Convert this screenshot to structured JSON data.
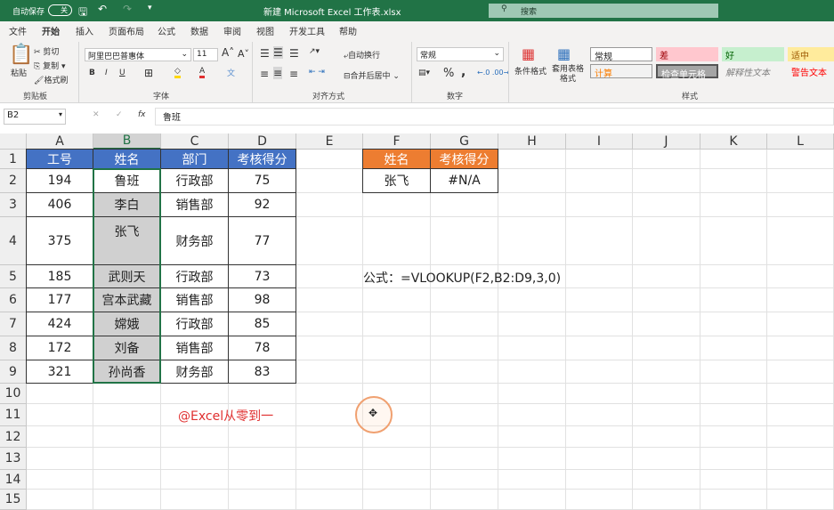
{
  "titlebar": {
    "autosave": "自动保存",
    "toggle": "关",
    "title": "新建 Microsoft Excel 工作表.xlsx",
    "search": "搜索"
  },
  "tabs": [
    "文件",
    "开始",
    "插入",
    "页面布局",
    "公式",
    "数据",
    "审阅",
    "视图",
    "开发工具",
    "帮助"
  ],
  "ribbon": {
    "clipboard": {
      "paste": "粘贴",
      "cut": "剪切",
      "copy": "复制",
      "format_painter": "格式刷",
      "label": "剪贴板"
    },
    "font": {
      "name": "阿里巴巴普惠体",
      "size": "11",
      "bold": "B",
      "italic": "I",
      "underline": "U",
      "label": "字体"
    },
    "align": {
      "wrap": "自动换行",
      "merge": "合并后居中",
      "label": "对齐方式"
    },
    "number": {
      "format": "常规",
      "percent": "%",
      "comma": ",",
      "label": "数字"
    },
    "styles": {
      "cond": "条件格式",
      "table": "套用表格格式",
      "label": "样式",
      "items": [
        {
          "t": "常规",
          "bg": "#ffffff",
          "fg": "#222222"
        },
        {
          "t": "差",
          "bg": "#ffc7ce",
          "fg": "#9c0006"
        },
        {
          "t": "好",
          "bg": "#c6efce",
          "fg": "#006100"
        },
        {
          "t": "适中",
          "bg": "#ffeb9c",
          "fg": "#9c5700"
        },
        {
          "t": "计算",
          "bg": "#f2f2f2",
          "fg": "#fa7d00"
        },
        {
          "t": "检查单元格",
          "bg": "#a5a5a5",
          "fg": "#ffffff"
        },
        {
          "t": "解释性文本",
          "bg": "#f3f2f1",
          "fg": "#7f7f7f"
        },
        {
          "t": "警告文本",
          "bg": "#f3f2f1",
          "fg": "#ff0000"
        }
      ]
    }
  },
  "formula_bar": {
    "name_box": "B2",
    "fx": "fx",
    "value": "鲁班"
  },
  "columns": [
    "A",
    "B",
    "C",
    "D",
    "E",
    "F",
    "G",
    "H",
    "I",
    "J",
    "K",
    "L"
  ],
  "rows": [
    "1",
    "2",
    "3",
    "4",
    "5",
    "6",
    "7",
    "8",
    "9",
    "10",
    "11",
    "12",
    "13",
    "14",
    "15"
  ],
  "table": {
    "headers": [
      "工号",
      "姓名",
      "部门",
      "考核得分"
    ],
    "rows": [
      [
        "194",
        "鲁班",
        "行政部",
        "75"
      ],
      [
        "406",
        "李白",
        "销售部",
        "92"
      ],
      [
        "375",
        "张飞",
        "财务部",
        "77"
      ],
      [
        "185",
        "武则天",
        "行政部",
        "73"
      ],
      [
        "177",
        "宫本武藏",
        "销售部",
        "98"
      ],
      [
        "424",
        "嫦娥",
        "行政部",
        "85"
      ],
      [
        "172",
        "刘备",
        "销售部",
        "78"
      ],
      [
        "321",
        "孙尚香",
        "财务部",
        "83"
      ]
    ]
  },
  "lookup": {
    "headers": [
      "姓名",
      "考核得分"
    ],
    "values": [
      "张飞",
      "#N/A"
    ]
  },
  "formula_note": "公式：=VLOOKUP(F2,B2:D9,3,0)",
  "watermark": "@Excel从零到一",
  "colors": {
    "green": "#217346",
    "blue": "#4472c4",
    "orange": "#ed7d31",
    "selection": "#d0d0d0",
    "red": "#e03030"
  }
}
